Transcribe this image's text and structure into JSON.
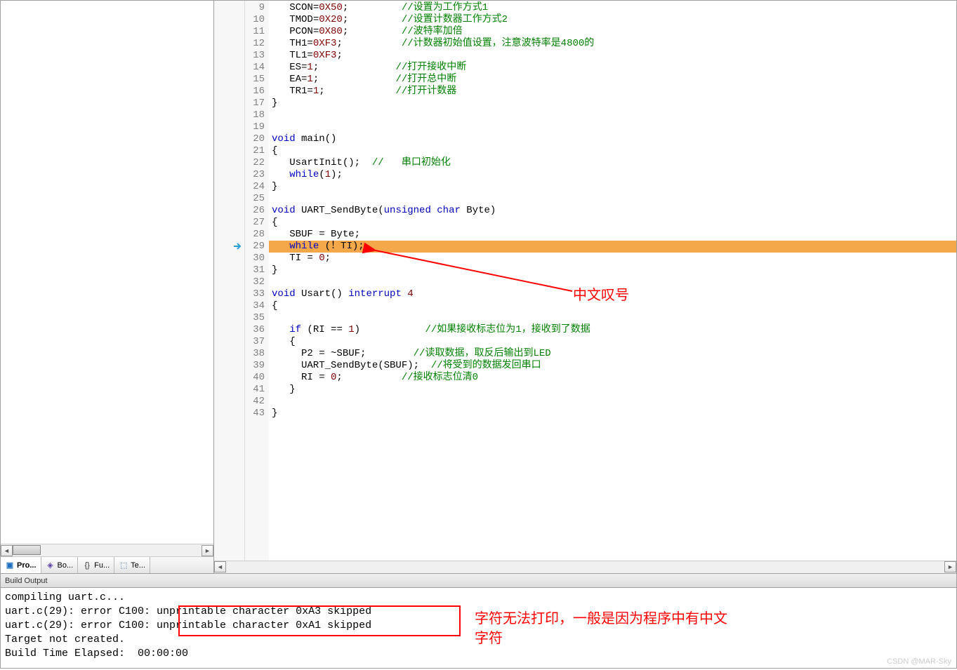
{
  "leftTabs": [
    {
      "label": "Pro...",
      "icon": "project",
      "color": "#1e6fbf"
    },
    {
      "label": "Bo...",
      "icon": "books",
      "color": "#5a3ea8"
    },
    {
      "label": "Fu...",
      "icon": "functions",
      "color": "#333"
    },
    {
      "label": "Te...",
      "icon": "templates",
      "color": "#2a5aa0"
    }
  ],
  "code": {
    "start": 9,
    "highlight": 29,
    "markerLine": 29,
    "lines": [
      {
        "n": 9,
        "segs": [
          {
            "t": "   SCON",
            "c": "fn"
          },
          {
            "t": "=",
            "c": "fn"
          },
          {
            "t": "0X50",
            "c": "num"
          },
          {
            "t": ";         ",
            "c": "fn"
          },
          {
            "t": "//设置为工作方式1",
            "c": "cm"
          }
        ]
      },
      {
        "n": 10,
        "segs": [
          {
            "t": "   TMOD",
            "c": "fn"
          },
          {
            "t": "=",
            "c": "fn"
          },
          {
            "t": "0X20",
            "c": "num"
          },
          {
            "t": ";         ",
            "c": "fn"
          },
          {
            "t": "//设置计数器工作方式2",
            "c": "cm"
          }
        ]
      },
      {
        "n": 11,
        "segs": [
          {
            "t": "   PCON",
            "c": "fn"
          },
          {
            "t": "=",
            "c": "fn"
          },
          {
            "t": "0X80",
            "c": "num"
          },
          {
            "t": ";         ",
            "c": "fn"
          },
          {
            "t": "//波特率加倍",
            "c": "cm"
          }
        ]
      },
      {
        "n": 12,
        "segs": [
          {
            "t": "   TH1",
            "c": "fn"
          },
          {
            "t": "=",
            "c": "fn"
          },
          {
            "t": "0XF3",
            "c": "num"
          },
          {
            "t": ";          ",
            "c": "fn"
          },
          {
            "t": "//计数器初始值设置，注意波特率是4800的",
            "c": "cm"
          }
        ]
      },
      {
        "n": 13,
        "segs": [
          {
            "t": "   TL1",
            "c": "fn"
          },
          {
            "t": "=",
            "c": "fn"
          },
          {
            "t": "0XF3",
            "c": "num"
          },
          {
            "t": ";",
            "c": "fn"
          }
        ]
      },
      {
        "n": 14,
        "segs": [
          {
            "t": "   ES",
            "c": "fn"
          },
          {
            "t": "=",
            "c": "fn"
          },
          {
            "t": "1",
            "c": "num"
          },
          {
            "t": ";             ",
            "c": "fn"
          },
          {
            "t": "//打开接收中断",
            "c": "cm"
          }
        ]
      },
      {
        "n": 15,
        "segs": [
          {
            "t": "   EA",
            "c": "fn"
          },
          {
            "t": "=",
            "c": "fn"
          },
          {
            "t": "1",
            "c": "num"
          },
          {
            "t": ";             ",
            "c": "fn"
          },
          {
            "t": "//打开总中断",
            "c": "cm"
          }
        ]
      },
      {
        "n": 16,
        "segs": [
          {
            "t": "   TR1",
            "c": "fn"
          },
          {
            "t": "=",
            "c": "fn"
          },
          {
            "t": "1",
            "c": "num"
          },
          {
            "t": ";            ",
            "c": "fn"
          },
          {
            "t": "//打开计数器",
            "c": "cm"
          }
        ]
      },
      {
        "n": 17,
        "segs": [
          {
            "t": "}",
            "c": "fn"
          }
        ]
      },
      {
        "n": 18,
        "segs": [
          {
            "t": "",
            "c": "fn"
          }
        ]
      },
      {
        "n": 19,
        "segs": [
          {
            "t": "",
            "c": "fn"
          }
        ]
      },
      {
        "n": 20,
        "segs": [
          {
            "t": "void",
            "c": "kw"
          },
          {
            "t": " main()",
            "c": "fn"
          }
        ]
      },
      {
        "n": 21,
        "segs": [
          {
            "t": "{",
            "c": "fn"
          }
        ]
      },
      {
        "n": 22,
        "segs": [
          {
            "t": "   UsartInit();  ",
            "c": "fn"
          },
          {
            "t": "//   串口初始化",
            "c": "cm"
          }
        ]
      },
      {
        "n": 23,
        "segs": [
          {
            "t": "   ",
            "c": "fn"
          },
          {
            "t": "while",
            "c": "kw"
          },
          {
            "t": "(",
            "c": "fn"
          },
          {
            "t": "1",
            "c": "num"
          },
          {
            "t": ");",
            "c": "fn"
          }
        ]
      },
      {
        "n": 24,
        "segs": [
          {
            "t": "}",
            "c": "fn"
          }
        ]
      },
      {
        "n": 25,
        "segs": [
          {
            "t": "",
            "c": "fn"
          }
        ]
      },
      {
        "n": 26,
        "segs": [
          {
            "t": "void",
            "c": "kw"
          },
          {
            "t": " UART_SendByte(",
            "c": "fn"
          },
          {
            "t": "unsigned",
            "c": "kw"
          },
          {
            "t": " ",
            "c": "fn"
          },
          {
            "t": "char",
            "c": "kw"
          },
          {
            "t": " Byte)",
            "c": "fn"
          }
        ]
      },
      {
        "n": 27,
        "segs": [
          {
            "t": "{",
            "c": "fn"
          }
        ]
      },
      {
        "n": 28,
        "segs": [
          {
            "t": "   SBUF = Byte;",
            "c": "fn"
          }
        ]
      },
      {
        "n": 29,
        "segs": [
          {
            "t": "   ",
            "c": "fn"
          },
          {
            "t": "while",
            "c": "kw"
          },
          {
            "t": " (！TI);",
            "c": "fn"
          }
        ]
      },
      {
        "n": 30,
        "segs": [
          {
            "t": "   TI = ",
            "c": "fn"
          },
          {
            "t": "0",
            "c": "num"
          },
          {
            "t": ";",
            "c": "fn"
          }
        ]
      },
      {
        "n": 31,
        "segs": [
          {
            "t": "}",
            "c": "fn"
          }
        ]
      },
      {
        "n": 32,
        "segs": [
          {
            "t": "",
            "c": "fn"
          }
        ]
      },
      {
        "n": 33,
        "segs": [
          {
            "t": "void",
            "c": "kw"
          },
          {
            "t": " Usart() ",
            "c": "fn"
          },
          {
            "t": "interrupt",
            "c": "kw"
          },
          {
            "t": " ",
            "c": "fn"
          },
          {
            "t": "4",
            "c": "num"
          }
        ]
      },
      {
        "n": 34,
        "segs": [
          {
            "t": "{",
            "c": "fn"
          }
        ]
      },
      {
        "n": 35,
        "segs": [
          {
            "t": "",
            "c": "fn"
          }
        ]
      },
      {
        "n": 36,
        "segs": [
          {
            "t": "   ",
            "c": "fn"
          },
          {
            "t": "if",
            "c": "kw"
          },
          {
            "t": " (RI == ",
            "c": "fn"
          },
          {
            "t": "1",
            "c": "num"
          },
          {
            "t": ")           ",
            "c": "fn"
          },
          {
            "t": "//如果接收标志位为1，接收到了数据",
            "c": "cm"
          }
        ]
      },
      {
        "n": 37,
        "segs": [
          {
            "t": "   {",
            "c": "fn"
          }
        ]
      },
      {
        "n": 38,
        "segs": [
          {
            "t": "     P2 = ~SBUF;        ",
            "c": "fn"
          },
          {
            "t": "//读取数据，取反后输出到LED",
            "c": "cm"
          }
        ]
      },
      {
        "n": 39,
        "segs": [
          {
            "t": "     UART_SendByte(SBUF);  ",
            "c": "fn"
          },
          {
            "t": "//将受到的数据发回串口",
            "c": "cm"
          }
        ]
      },
      {
        "n": 40,
        "segs": [
          {
            "t": "     RI = ",
            "c": "fn"
          },
          {
            "t": "0",
            "c": "num"
          },
          {
            "t": ";          ",
            "c": "fn"
          },
          {
            "t": "//接收标志位清0",
            "c": "cm"
          }
        ]
      },
      {
        "n": 41,
        "segs": [
          {
            "t": "   }",
            "c": "fn"
          }
        ]
      },
      {
        "n": 42,
        "segs": [
          {
            "t": "",
            "c": "fn"
          }
        ]
      },
      {
        "n": 43,
        "segs": [
          {
            "t": "}",
            "c": "fn"
          }
        ]
      }
    ]
  },
  "annotations": {
    "arrow1_label": "中文叹号",
    "box_label_l1": "字符无法打印，一般是因为程序中有中文",
    "box_label_l2": "字符"
  },
  "buildHeader": "Build Output",
  "buildLines": [
    "compiling uart.c...",
    "uart.c(29): error C100: unprintable character 0xA3 skipped",
    "uart.c(29): error C100: unprintable character 0xA1 skipped",
    "Target not created.",
    "Build Time Elapsed:  00:00:00"
  ],
  "watermark": "CSDN @MAR-Sky"
}
